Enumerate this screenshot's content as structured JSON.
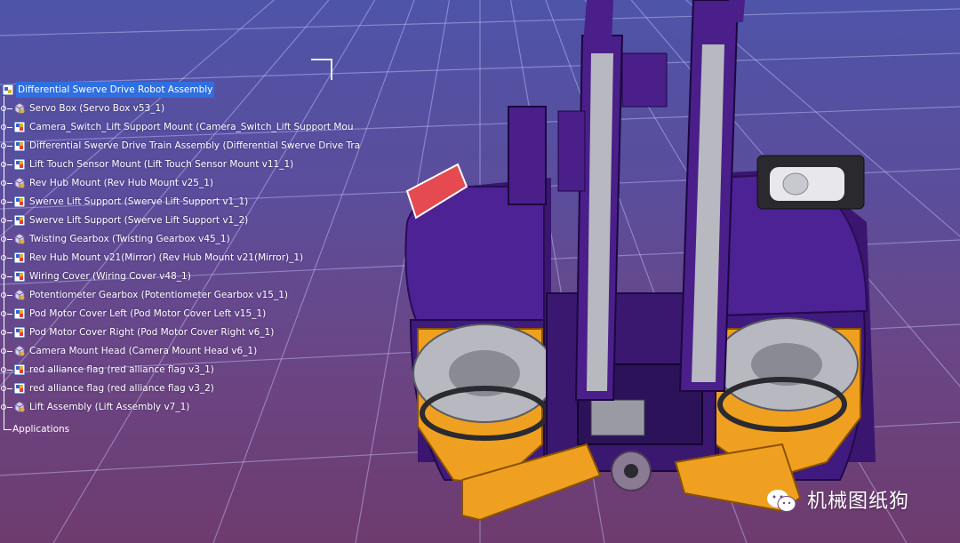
{
  "tree": {
    "root_label": "Differential Swerve Drive Robot Assembly",
    "items": [
      {
        "label": "Servo Box (Servo Box v53_1)",
        "icon": "part-icon"
      },
      {
        "label": "Camera_Switch_Lift Support Mount (Camera_Switch_Lift Support Mou",
        "icon": "assembly-icon"
      },
      {
        "label": "Differential Swerve Drive Train Assembly (Differential Swerve Drive Tra",
        "icon": "assembly-icon"
      },
      {
        "label": "Lift Touch Sensor Mount (Lift Touch Sensor Mount v11_1)",
        "icon": "assembly-icon"
      },
      {
        "label": "Rev Hub Mount (Rev Hub Mount v25_1)",
        "icon": "part-icon"
      },
      {
        "label": "Swerve Lift Support (Swerve Lift Support v1_1)",
        "icon": "assembly-icon"
      },
      {
        "label": "Swerve Lift Support (Swerve Lift Support v1_2)",
        "icon": "assembly-icon"
      },
      {
        "label": "Twisting Gearbox (Twisting Gearbox v45_1)",
        "icon": "part-icon"
      },
      {
        "label": "Rev Hub Mount v21(Mirror) (Rev Hub Mount v21(Mirror)_1)",
        "icon": "assembly-icon"
      },
      {
        "label": "Wiring Cover (Wiring Cover v48_1)",
        "icon": "assembly-icon"
      },
      {
        "label": "Potentiometer Gearbox (Potentiometer Gearbox v15_1)",
        "icon": "part-icon"
      },
      {
        "label": "Pod Motor Cover Left (Pod Motor Cover Left v15_1)",
        "icon": "assembly-icon"
      },
      {
        "label": "Pod Motor Cover Right (Pod Motor Cover Right v6_1)",
        "icon": "assembly-icon"
      },
      {
        "label": "Camera Mount Head (Camera Mount Head v6_1)",
        "icon": "part-icon"
      },
      {
        "label": "red alliance flag (red alliance flag v3_1)",
        "icon": "assembly-icon"
      },
      {
        "label": "red alliance flag (red alliance flag v3_2)",
        "icon": "assembly-icon"
      },
      {
        "label": "Lift Assembly (Lift Assembly v7_1)",
        "icon": "part-icon"
      }
    ],
    "applications_label": "Applications"
  },
  "watermark": {
    "text": "机械图纸狗",
    "icon": "wechat-icon"
  },
  "colors": {
    "background_top": "#4e54a8",
    "background_bottom": "#6e3b6e",
    "robot_body": "#4a1f8a",
    "robot_accent": "#f0a020",
    "robot_metal": "#b8b8c0",
    "selection": "#2f6fe0"
  }
}
